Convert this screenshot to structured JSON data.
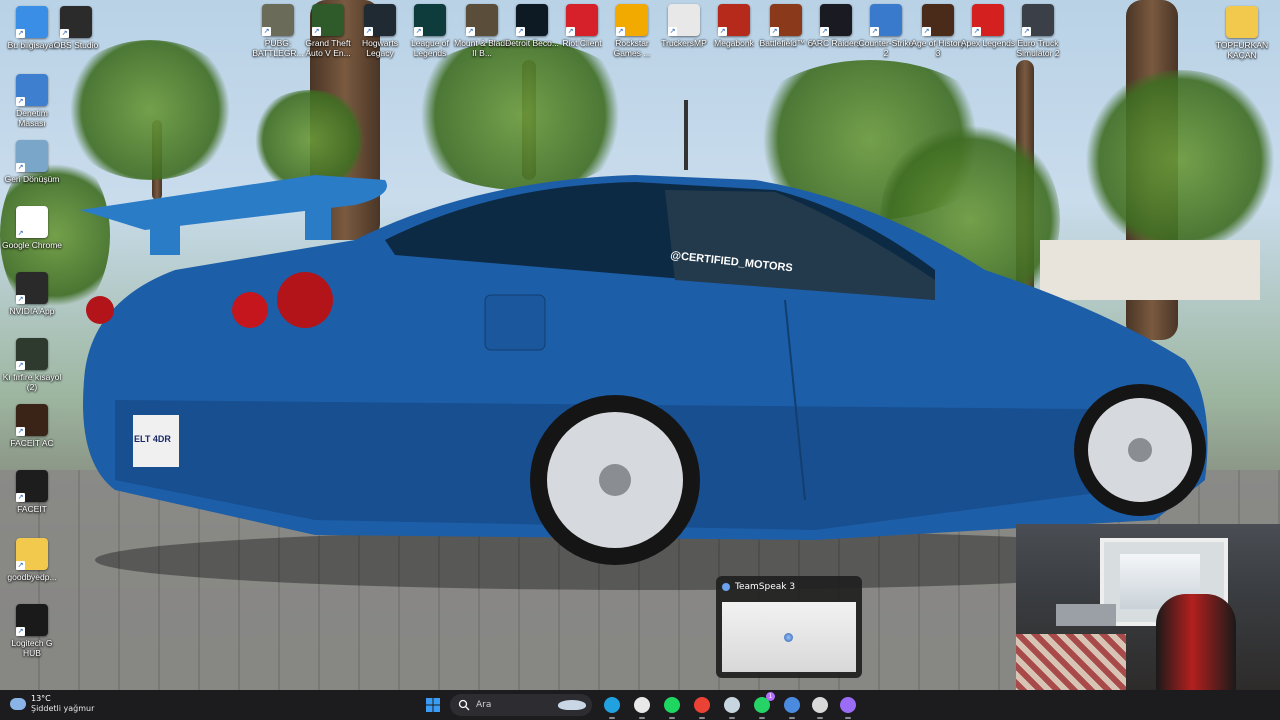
{
  "desktop_left": [
    {
      "label": "Bu bilgisayar",
      "icon": "monitor-icon",
      "color": "#3a8ee6"
    },
    {
      "label": "OBS Studio",
      "icon": "obs-icon",
      "color": "#2b2b2b"
    },
    {
      "label": "Denetim Masası",
      "icon": "control-panel-icon",
      "color": "#3f7fd0"
    },
    {
      "label": "Geri Dönüşüm",
      "icon": "recycle-bin-icon",
      "color": "#7aa6c9"
    },
    {
      "label": "Google Chrome",
      "icon": "chrome-icon",
      "color": "#ffffff"
    },
    {
      "label": "NVIDIA App",
      "icon": "nvidia-icon",
      "color": "#2a2a2a"
    },
    {
      "label": "Kı fırfire kısayol (2)",
      "icon": "file-shortcut-icon",
      "color": "#2f3a2f"
    },
    {
      "label": "FACEIT AC",
      "icon": "faceit-ac-icon",
      "color": "#3a2418"
    },
    {
      "label": "FACEIT",
      "icon": "faceit-icon",
      "color": "#1d1d1d"
    },
    {
      "label": "goodbyedp...",
      "icon": "folder-icon",
      "color": "#f2c94c"
    },
    {
      "label": "Logitech G HUB",
      "icon": "logitech-icon",
      "color": "#1a1a1a"
    }
  ],
  "desktop_top": [
    {
      "label": "PUBG: BATTLEGR...",
      "icon": "pubg-icon",
      "color": "#6b6b5a"
    },
    {
      "label": "Grand Theft Auto V En...",
      "icon": "gta-icon",
      "color": "#2f5a2a"
    },
    {
      "label": "Hogwarts Legacy",
      "icon": "hogwarts-icon",
      "color": "#1f2a33"
    },
    {
      "label": "League of Legends",
      "icon": "lol-icon",
      "color": "#0e3b3b"
    },
    {
      "label": "Mount & Blade II B...",
      "icon": "bannerlord-icon",
      "color": "#5a4e3a"
    },
    {
      "label": "Detroit Beco...",
      "icon": "detroit-icon",
      "color": "#0d1a24"
    },
    {
      "label": "Riot Client",
      "icon": "riot-icon",
      "color": "#d6202a"
    },
    {
      "label": "Rockstar Games ...",
      "icon": "rockstar-icon",
      "color": "#f2a900"
    },
    {
      "label": "TruckersMP",
      "icon": "truckersmp-icon",
      "color": "#e8e8e8"
    },
    {
      "label": "Megabonk",
      "icon": "megabonk-icon",
      "color": "#b52a1a"
    },
    {
      "label": "Battlefield™ 6",
      "icon": "battlefield-icon",
      "color": "#8a3a1a"
    },
    {
      "label": "ARC Raiders",
      "icon": "arc-raiders-icon",
      "color": "#1a1a22"
    },
    {
      "label": "Counter-Strike 2",
      "icon": "cs2-icon",
      "color": "#3a7acc"
    },
    {
      "label": "Age of History 3",
      "icon": "age-of-history-icon",
      "color": "#4a2a18"
    },
    {
      "label": "Apex Legends",
      "icon": "apex-icon",
      "color": "#d4201e"
    },
    {
      "label": "Euro Truck Simulator 2",
      "icon": "ets2-icon",
      "color": "#3a3f48"
    }
  ],
  "desktop_right": {
    "label": "TOPFURKAN KAÇAN",
    "icon": "folder-icon",
    "color": "#f2c94c"
  },
  "wallpaper": {
    "car_sticker": "@CERTIFIED_MOTORS",
    "plate": "ELT 4DR"
  },
  "teamspeak_preview": {
    "title": "TeamSpeak 3"
  },
  "taskbar": {
    "weather": {
      "temp": "13°C",
      "condition": "Şiddetli yağmur"
    },
    "search_placeholder": "Ara",
    "apps": [
      {
        "name": "start-button",
        "icon": "windows-icon",
        "color": "#3b9cf5"
      },
      {
        "name": "search",
        "icon": "search-icon",
        "color": "#ffffff"
      },
      {
        "name": "task-view",
        "icon": "boat-icon",
        "color": "#c9d6e6"
      },
      {
        "name": "edge",
        "icon": "edge-icon",
        "color": "#21a1e0"
      },
      {
        "name": "snipping",
        "icon": "snip-icon",
        "color": "#e8e8e8"
      },
      {
        "name": "spotify",
        "icon": "spotify-icon",
        "color": "#1ed760"
      },
      {
        "name": "chrome",
        "icon": "chrome-icon",
        "color": "#ea4335"
      },
      {
        "name": "steam",
        "icon": "steam-icon",
        "color": "#c7d5e0"
      },
      {
        "name": "whatsapp",
        "icon": "whatsapp-icon",
        "color": "#25d366",
        "badge": "1"
      },
      {
        "name": "teamspeak",
        "icon": "teamspeak-icon",
        "color": "#4a8be0"
      },
      {
        "name": "obs",
        "icon": "obs-icon",
        "color": "#d9d9d9"
      },
      {
        "name": "app",
        "icon": "grid-app-icon",
        "color": "#9b6cf5"
      }
    ]
  }
}
